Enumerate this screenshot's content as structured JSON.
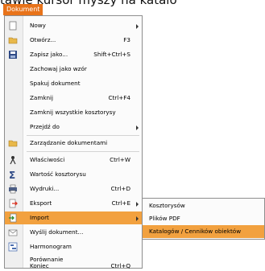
{
  "top_text": "tawie kursor myszy na katalo",
  "menubar": {
    "tab": "Dokument"
  },
  "menu": {
    "items": [
      {
        "label": "Nowy",
        "shortcut": "",
        "icon": "blank-page-icon",
        "submenu": true
      },
      {
        "label": "Otwórz...",
        "shortcut": "F3",
        "icon": "open-folder-icon"
      },
      {
        "label": "Zapisz jako...",
        "shortcut": "Shift+Ctrl+S",
        "icon": "save-disk-icon"
      },
      {
        "label": "Zachowaj jako wzór",
        "shortcut": "",
        "icon": ""
      },
      {
        "label": "Spakuj dokument",
        "shortcut": "",
        "icon": ""
      },
      {
        "label": "Zamknij",
        "shortcut": "Ctrl+F4",
        "icon": ""
      },
      {
        "label": "Zamknij wszystkie kosztorysy",
        "shortcut": "",
        "icon": ""
      },
      {
        "label": "Przejdź do",
        "shortcut": "",
        "icon": "",
        "submenu": true
      },
      {
        "label": "Zarządzanie dokumentami",
        "shortcut": "",
        "icon": "folder-icon"
      },
      {
        "label": "Właściwości",
        "shortcut": "Ctrl+W",
        "icon": "properties-icon"
      },
      {
        "label": "Wartość kosztorysu",
        "shortcut": "",
        "icon": "sigma-icon"
      },
      {
        "label": "Wydruki...",
        "shortcut": "Ctrl+D",
        "icon": "printer-icon"
      },
      {
        "label": "Eksport",
        "shortcut": "Ctrl+E",
        "icon": "export-icon",
        "submenu": true
      },
      {
        "label": "Import",
        "shortcut": "",
        "icon": "import-icon",
        "submenu": true,
        "highlighted": true
      },
      {
        "label": "Wyślij dokument...",
        "shortcut": "",
        "icon": "envelope-icon"
      },
      {
        "label": "Harmonogram",
        "shortcut": "",
        "icon": "schedule-icon"
      },
      {
        "label": "Porównanie",
        "shortcut": "",
        "icon": ""
      },
      {
        "label": "Koniec",
        "shortcut": "Ctrl+Q",
        "icon": ""
      }
    ]
  },
  "submenu": {
    "items": [
      {
        "label": "Kosztorysów"
      },
      {
        "label": "Plików PDF"
      },
      {
        "label": "Katalogów / Cenników obiektów",
        "highlighted": true
      }
    ]
  },
  "colors": {
    "accent": "#e8731a",
    "highlight": "#f2a13f"
  }
}
